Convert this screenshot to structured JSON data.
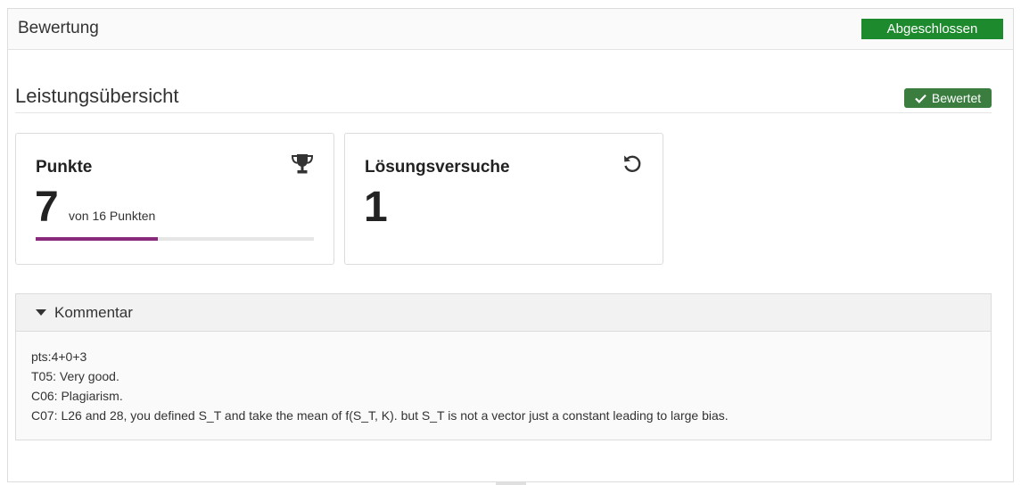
{
  "panel": {
    "title": "Bewertung",
    "status_button": "Abgeschlossen"
  },
  "overview": {
    "title": "Leistungsübersicht",
    "badge": "Bewertet",
    "badge_icon": "check-icon"
  },
  "points_card": {
    "title": "Punkte",
    "icon": "trophy-icon",
    "value": "7",
    "subtitle": "von 16 Punkten",
    "progress_fraction": 0.4375,
    "progress_color": "#8a2a7c"
  },
  "attempts_card": {
    "title": "Lösungsversuche",
    "icon": "retry-icon",
    "value": "1"
  },
  "comment": {
    "header": "Kommentar",
    "lines": [
      "pts:4+0+3",
      "T05: Very good.",
      "C06: Plagiarism.",
      "C07: L26 and 28, you defined S_T and take the mean of f(S_T, K). but S_T is not a vector just a constant leading to large bias."
    ]
  },
  "colors": {
    "status_green": "#1e8a2e",
    "badge_green": "#3a7d3f"
  }
}
